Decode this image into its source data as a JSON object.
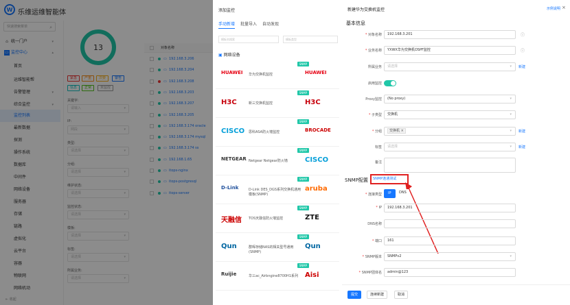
{
  "app": {
    "title": "乐维运维智能体",
    "logo_letter": "W"
  },
  "sidebar": {
    "search_placeholder": "快速搜索菜单",
    "items": [
      {
        "label": "统一门户"
      },
      {
        "label": "监控中心"
      },
      {
        "label": "首页"
      },
      {
        "label": "运维智能帮"
      },
      {
        "label": "告警管理"
      },
      {
        "label": "综合监控"
      },
      {
        "label": "监控列表"
      },
      {
        "label": "最新数据"
      },
      {
        "label": "探测"
      },
      {
        "label": "操作系统"
      },
      {
        "label": "数据库"
      },
      {
        "label": "中间件"
      },
      {
        "label": "网络设备"
      },
      {
        "label": "服务器"
      },
      {
        "label": "存储"
      },
      {
        "label": "链路"
      },
      {
        "label": "虚拟化"
      },
      {
        "label": "云平台"
      },
      {
        "label": "容器"
      },
      {
        "label": "物联网"
      },
      {
        "label": "网络机动"
      }
    ],
    "footer": "收起"
  },
  "midpanel": {
    "total": "13",
    "tags": [
      "紧急",
      "严重",
      "次要",
      "警告",
      "信息",
      "正常",
      "未监控"
    ],
    "filters": [
      {
        "label": "关键字:",
        "placeholder": "请输入"
      },
      {
        "label": "IP:",
        "placeholder": "网段"
      },
      {
        "label": "类型:",
        "placeholder": "请选择"
      },
      {
        "label": "分组:",
        "placeholder": "请选择"
      },
      {
        "label": "维护状态:",
        "placeholder": "请选择"
      },
      {
        "label": "监控状态:",
        "placeholder": "请选择"
      },
      {
        "label": "模板:",
        "placeholder": "请选择"
      },
      {
        "label": "标签:",
        "placeholder": "请选择"
      },
      {
        "label": "所属业务:",
        "placeholder": "请选择"
      }
    ]
  },
  "table": {
    "header": "对象名称",
    "rows": [
      "192.168.3.206",
      "192.168.3.204",
      "192.168.3.208",
      "192.168.3.203",
      "192.168.3.207",
      "192.168.3.205",
      "192.168.3.174 oracle",
      "192.168.3.174 mysql",
      "192.168.3.174 ss",
      "192.168.1.65",
      "itops-nginx",
      "itops-postgresql",
      "itops-server"
    ]
  },
  "addpanel": {
    "title": "添加监控",
    "tabs": [
      "手动新增",
      "批量导入",
      "自动发现"
    ],
    "search_placeholder": "模板名搜索",
    "filter_placeholder": "模板类型",
    "category": "网络设备",
    "badge": "SNMP",
    "cards": [
      {
        "brand": "HUAWEI",
        "name": "华为交换机监控"
      },
      {
        "brand": "H3C",
        "name": "新三交换机监控"
      },
      {
        "brand": "CISCO",
        "name": "思科ASA防火墙监控"
      },
      {
        "brand": "NETGEAR",
        "name": "Netgear Netgear防火墙"
      },
      {
        "brand": "D-Link",
        "name": "D-Link DES_DGS系列交换机通用模板(SNMP)"
      },
      {
        "brand": "天融信",
        "name": "TOS天融信防火墙监控"
      },
      {
        "brand": "Qun",
        "name": "群晖存储NAS的相关型号通用(SNMP)"
      },
      {
        "brand": "Ruijie",
        "name": "华三ac_Airbngine8700H1系列"
      }
    ],
    "right_brands": [
      "HUAWEI",
      "H3C",
      "BROCADE",
      "CISCO",
      "aruba",
      "ZTE",
      "Qun",
      "Aisi"
    ]
  },
  "drawer": {
    "title": "新建华为交换机监控",
    "example_link": "示例说明",
    "close": "×",
    "basic_section": "基本信息",
    "fields": [
      {
        "label": "对象名称",
        "value": "192.168.3.201",
        "required": true,
        "ph": false
      },
      {
        "label": "业务名称",
        "value": "YXWX华为交换机OSPF监控",
        "required": true,
        "ph": false
      },
      {
        "label": "所属业务",
        "value": "请选择",
        "required": false,
        "ph": true
      },
      {
        "label": "启用监控",
        "value": "",
        "required": false,
        "ph": false
      },
      {
        "label": "Proxy监控",
        "value": "(No proxy)",
        "required": false,
        "ph": false
      },
      {
        "label": "子类型",
        "value": "交换机",
        "required": true,
        "ph": false
      },
      {
        "label": "分组",
        "value": "交换机 ×",
        "required": true,
        "ph": false
      },
      {
        "label": "标签",
        "value": "请选择",
        "required": false,
        "ph": true
      },
      {
        "label": "备注",
        "value": "",
        "required": false,
        "ph": false
      }
    ],
    "snmp_section": "SNMP配置",
    "snmp_test": "SNMP连通测试",
    "conn_label": "连接类型",
    "conn_ip": "IP",
    "conn_dns": "DNS",
    "snmp_fields": [
      {
        "label": "IP",
        "value": "192.168.3.201",
        "required": true
      },
      {
        "label": "DNS名称",
        "value": "",
        "required": false
      },
      {
        "label": "端口",
        "value": "161",
        "required": true
      },
      {
        "label": "SNMP版本",
        "value": "SNMPv2",
        "required": true
      },
      {
        "label": "SNMP团体名",
        "value": "admin@123",
        "required": true
      }
    ],
    "new_label": "新建",
    "buttons": {
      "submit": "提交",
      "continue": "连续新建",
      "cancel": "取消"
    }
  }
}
